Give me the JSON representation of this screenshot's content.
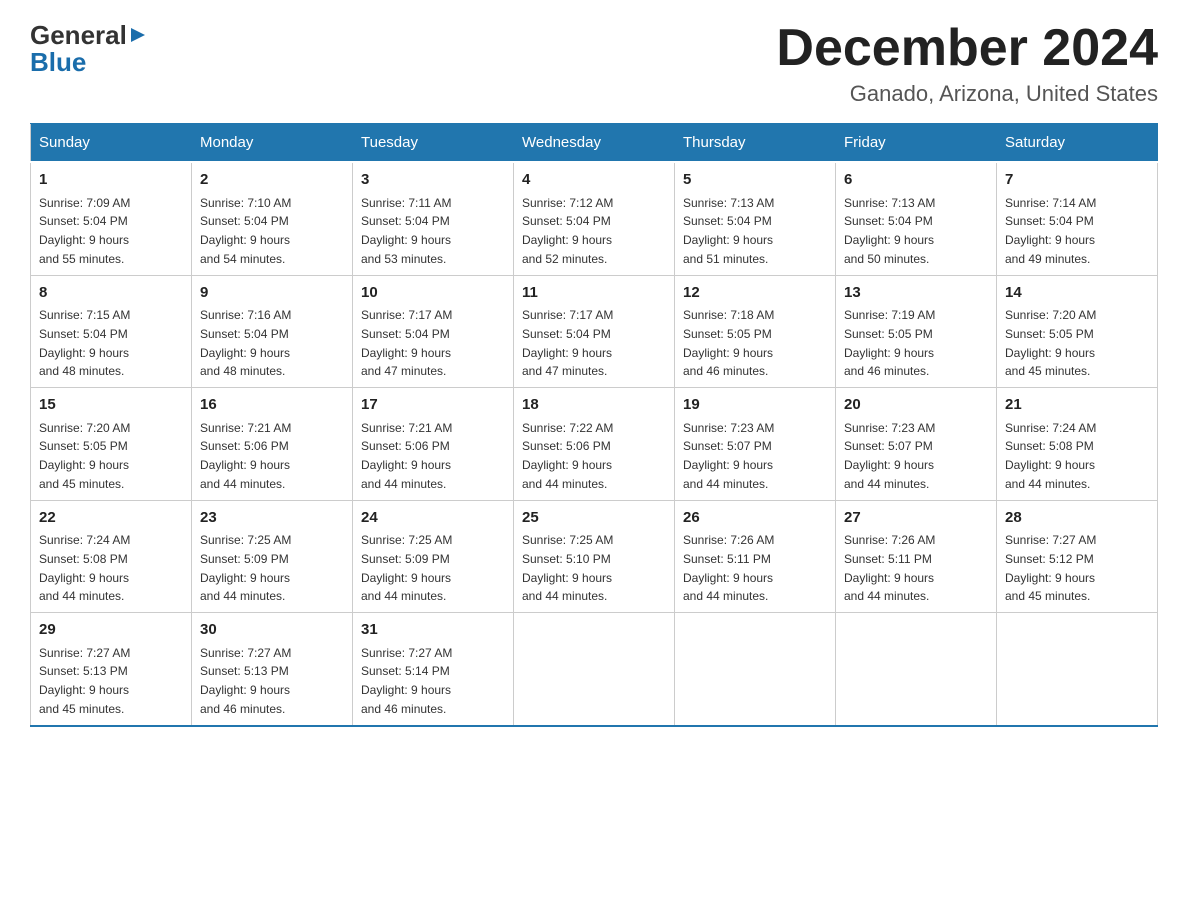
{
  "header": {
    "logo_general": "General",
    "logo_blue": "Blue",
    "month_title": "December 2024",
    "location": "Ganado, Arizona, United States"
  },
  "calendar": {
    "days_of_week": [
      "Sunday",
      "Monday",
      "Tuesday",
      "Wednesday",
      "Thursday",
      "Friday",
      "Saturday"
    ],
    "weeks": [
      [
        {
          "day": "1",
          "sunrise": "7:09 AM",
          "sunset": "5:04 PM",
          "daylight": "9 hours and 55 minutes."
        },
        {
          "day": "2",
          "sunrise": "7:10 AM",
          "sunset": "5:04 PM",
          "daylight": "9 hours and 54 minutes."
        },
        {
          "day": "3",
          "sunrise": "7:11 AM",
          "sunset": "5:04 PM",
          "daylight": "9 hours and 53 minutes."
        },
        {
          "day": "4",
          "sunrise": "7:12 AM",
          "sunset": "5:04 PM",
          "daylight": "9 hours and 52 minutes."
        },
        {
          "day": "5",
          "sunrise": "7:13 AM",
          "sunset": "5:04 PM",
          "daylight": "9 hours and 51 minutes."
        },
        {
          "day": "6",
          "sunrise": "7:13 AM",
          "sunset": "5:04 PM",
          "daylight": "9 hours and 50 minutes."
        },
        {
          "day": "7",
          "sunrise": "7:14 AM",
          "sunset": "5:04 PM",
          "daylight": "9 hours and 49 minutes."
        }
      ],
      [
        {
          "day": "8",
          "sunrise": "7:15 AM",
          "sunset": "5:04 PM",
          "daylight": "9 hours and 48 minutes."
        },
        {
          "day": "9",
          "sunrise": "7:16 AM",
          "sunset": "5:04 PM",
          "daylight": "9 hours and 48 minutes."
        },
        {
          "day": "10",
          "sunrise": "7:17 AM",
          "sunset": "5:04 PM",
          "daylight": "9 hours and 47 minutes."
        },
        {
          "day": "11",
          "sunrise": "7:17 AM",
          "sunset": "5:04 PM",
          "daylight": "9 hours and 47 minutes."
        },
        {
          "day": "12",
          "sunrise": "7:18 AM",
          "sunset": "5:05 PM",
          "daylight": "9 hours and 46 minutes."
        },
        {
          "day": "13",
          "sunrise": "7:19 AM",
          "sunset": "5:05 PM",
          "daylight": "9 hours and 46 minutes."
        },
        {
          "day": "14",
          "sunrise": "7:20 AM",
          "sunset": "5:05 PM",
          "daylight": "9 hours and 45 minutes."
        }
      ],
      [
        {
          "day": "15",
          "sunrise": "7:20 AM",
          "sunset": "5:05 PM",
          "daylight": "9 hours and 45 minutes."
        },
        {
          "day": "16",
          "sunrise": "7:21 AM",
          "sunset": "5:06 PM",
          "daylight": "9 hours and 44 minutes."
        },
        {
          "day": "17",
          "sunrise": "7:21 AM",
          "sunset": "5:06 PM",
          "daylight": "9 hours and 44 minutes."
        },
        {
          "day": "18",
          "sunrise": "7:22 AM",
          "sunset": "5:06 PM",
          "daylight": "9 hours and 44 minutes."
        },
        {
          "day": "19",
          "sunrise": "7:23 AM",
          "sunset": "5:07 PM",
          "daylight": "9 hours and 44 minutes."
        },
        {
          "day": "20",
          "sunrise": "7:23 AM",
          "sunset": "5:07 PM",
          "daylight": "9 hours and 44 minutes."
        },
        {
          "day": "21",
          "sunrise": "7:24 AM",
          "sunset": "5:08 PM",
          "daylight": "9 hours and 44 minutes."
        }
      ],
      [
        {
          "day": "22",
          "sunrise": "7:24 AM",
          "sunset": "5:08 PM",
          "daylight": "9 hours and 44 minutes."
        },
        {
          "day": "23",
          "sunrise": "7:25 AM",
          "sunset": "5:09 PM",
          "daylight": "9 hours and 44 minutes."
        },
        {
          "day": "24",
          "sunrise": "7:25 AM",
          "sunset": "5:09 PM",
          "daylight": "9 hours and 44 minutes."
        },
        {
          "day": "25",
          "sunrise": "7:25 AM",
          "sunset": "5:10 PM",
          "daylight": "9 hours and 44 minutes."
        },
        {
          "day": "26",
          "sunrise": "7:26 AM",
          "sunset": "5:11 PM",
          "daylight": "9 hours and 44 minutes."
        },
        {
          "day": "27",
          "sunrise": "7:26 AM",
          "sunset": "5:11 PM",
          "daylight": "9 hours and 44 minutes."
        },
        {
          "day": "28",
          "sunrise": "7:27 AM",
          "sunset": "5:12 PM",
          "daylight": "9 hours and 45 minutes."
        }
      ],
      [
        {
          "day": "29",
          "sunrise": "7:27 AM",
          "sunset": "5:13 PM",
          "daylight": "9 hours and 45 minutes."
        },
        {
          "day": "30",
          "sunrise": "7:27 AM",
          "sunset": "5:13 PM",
          "daylight": "9 hours and 46 minutes."
        },
        {
          "day": "31",
          "sunrise": "7:27 AM",
          "sunset": "5:14 PM",
          "daylight": "9 hours and 46 minutes."
        },
        null,
        null,
        null,
        null
      ]
    ],
    "labels": {
      "sunrise": "Sunrise:",
      "sunset": "Sunset:",
      "daylight": "Daylight:"
    }
  }
}
